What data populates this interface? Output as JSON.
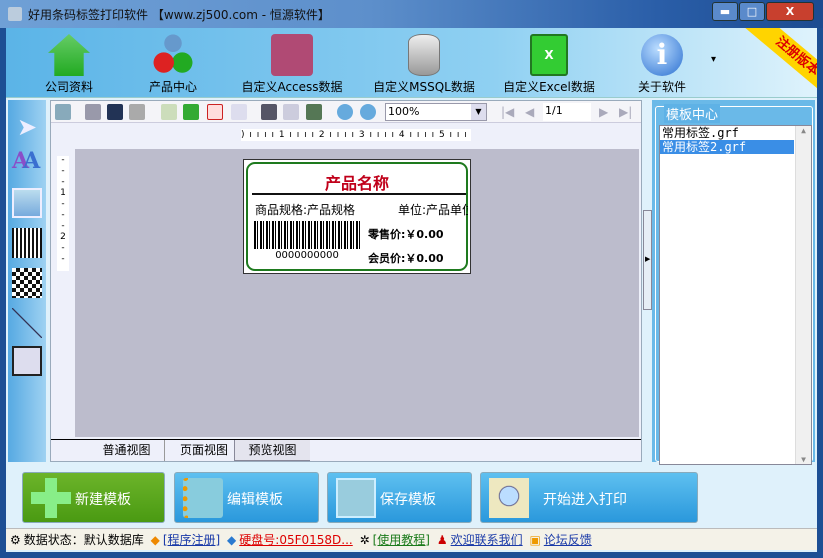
{
  "window": {
    "title": "好用条码标签打印软件 【www.zj500.com - 恒源软件】",
    "min": "▬",
    "max": "□",
    "close": "X"
  },
  "toolbar": {
    "items": [
      {
        "label": "公司资料",
        "icon": "house-icon"
      },
      {
        "label": "产品中心",
        "icon": "cubes-icon"
      },
      {
        "label": "自定义Access数据",
        "icon": "access-key-icon"
      },
      {
        "label": "自定义MSSQL数据",
        "icon": "database-icon"
      },
      {
        "label": "自定义Excel数据",
        "icon": "excel-icon"
      },
      {
        "label": "关于软件",
        "icon": "info-icon"
      }
    ],
    "more": "▾",
    "ribbon": "注册版本"
  },
  "designer": {
    "zoom": "100%",
    "page": "1/1",
    "hruler": ") ı ı ı ı 1 ı ı ı ı 2 ı ı ı ı 3 ı ı ı ı 4 ı ı ı ı 5 ı ı ı ı",
    "vruler": [
      "-",
      "-",
      "-",
      "1",
      "-",
      "-",
      "-",
      "2",
      "-",
      "-"
    ]
  },
  "label": {
    "title": "产品名称",
    "spec": "商品规格:产品规格",
    "unit": "单位:产品单位",
    "barcode": "0000000000",
    "retail": "零售价:￥0.00",
    "member": "会员价:￥0.00",
    "title_color": "#c0001a",
    "border_color": "#1e7a1e"
  },
  "tabs": [
    "普通视图",
    "页面视图",
    "预览视图"
  ],
  "templates": {
    "title": "模板中心",
    "items": [
      "常用标签.grf",
      "常用标签2.grf"
    ],
    "selected": 1
  },
  "actions": [
    {
      "label": "新建模板",
      "color": "#5aa51e"
    },
    {
      "label": "编辑模板",
      "color": "#34a3e3"
    },
    {
      "label": "保存模板",
      "color": "#34a3e3"
    },
    {
      "label": "开始进入打印",
      "color": "#34a3e3"
    }
  ],
  "status": {
    "db_label": "数据状态：默认数据库",
    "register": "[程序注册]",
    "disk": "硬盘号:05F0158D...",
    "tutorial": "[使用教程]",
    "contact": "欢迎联系我们",
    "forum": "论坛反馈"
  }
}
